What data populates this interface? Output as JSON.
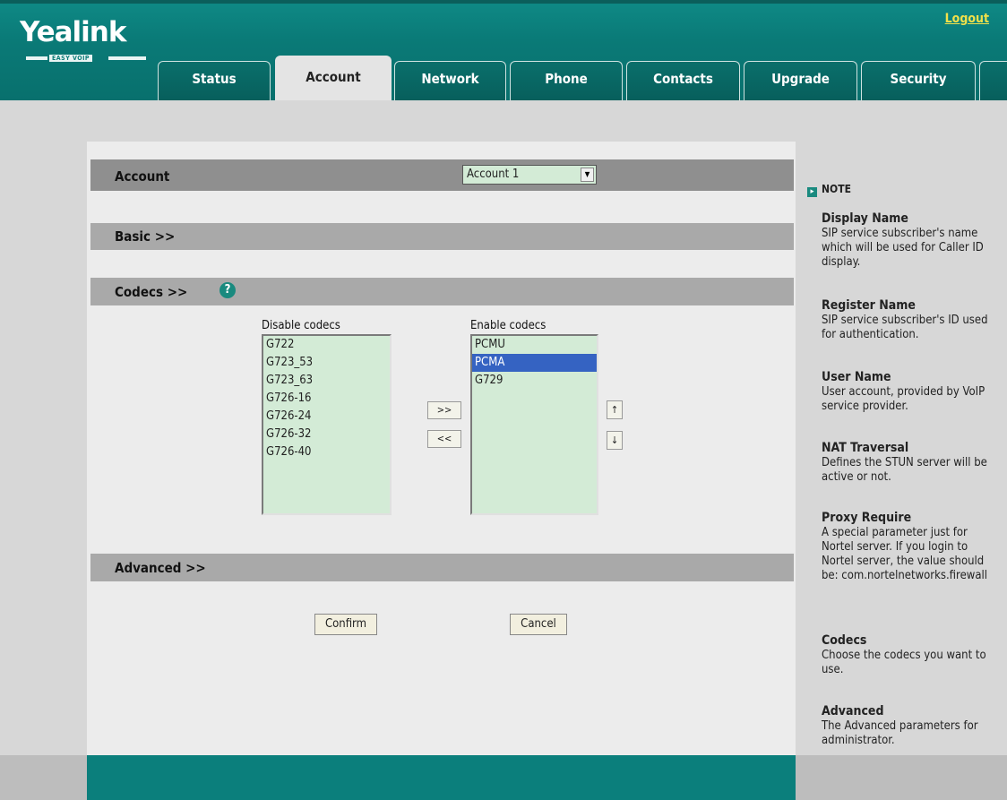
{
  "brand": {
    "name": "Yealink",
    "tagline": "EASY VOIP"
  },
  "header": {
    "logout": "Logout"
  },
  "tabs": [
    {
      "label": "Status"
    },
    {
      "label": "Account"
    },
    {
      "label": "Network"
    },
    {
      "label": "Phone"
    },
    {
      "label": "Contacts"
    },
    {
      "label": "Upgrade"
    },
    {
      "label": "Security"
    }
  ],
  "active_tab": "Account",
  "account": {
    "section_label": "Account",
    "selected_account": "Account 1"
  },
  "sections": {
    "basic": "Basic >>",
    "codecs": "Codecs >>",
    "advanced": "Advanced >>"
  },
  "codecs": {
    "help_icon": "question-icon",
    "disable_label": "Disable codecs",
    "enable_label": "Enable codecs",
    "disabled": [
      "G722",
      "G723_53",
      "G723_63",
      "G726-16",
      "G726-24",
      "G726-32",
      "G726-40"
    ],
    "enabled": [
      "PCMU",
      "PCMA",
      "G729"
    ],
    "selected_enabled": "PCMA",
    "move_right": ">>",
    "move_left": "<<",
    "move_up": "↑",
    "move_down": "↓"
  },
  "actions": {
    "confirm": "Confirm",
    "cancel": "Cancel"
  },
  "note": {
    "title": "NOTE",
    "items": [
      {
        "title": "Display Name",
        "desc": "SIP service subscriber's name which will be used for Caller ID display."
      },
      {
        "title": "Register Name",
        "desc": "SIP service subscriber's ID used for authentication."
      },
      {
        "title": "User Name",
        "desc": "User account, provided by VoIP service provider."
      },
      {
        "title": "NAT Traversal",
        "desc": "Defines the STUN server will be active or not."
      },
      {
        "title": "Proxy Require",
        "desc": "A special parameter just for Nortel server. If you login to Nortel server, the value should be: com.nortelnetworks.firewall"
      },
      {
        "title": "Codecs",
        "desc": "Choose the codecs you want to use."
      },
      {
        "title": "Advanced",
        "desc": "The Advanced parameters for administrator."
      }
    ]
  },
  "colors": {
    "header_teal": "#0a7a77",
    "logout_yellow": "#f1e04a",
    "listbox_green": "#d3ebd6",
    "selection_blue": "#3563c2"
  }
}
